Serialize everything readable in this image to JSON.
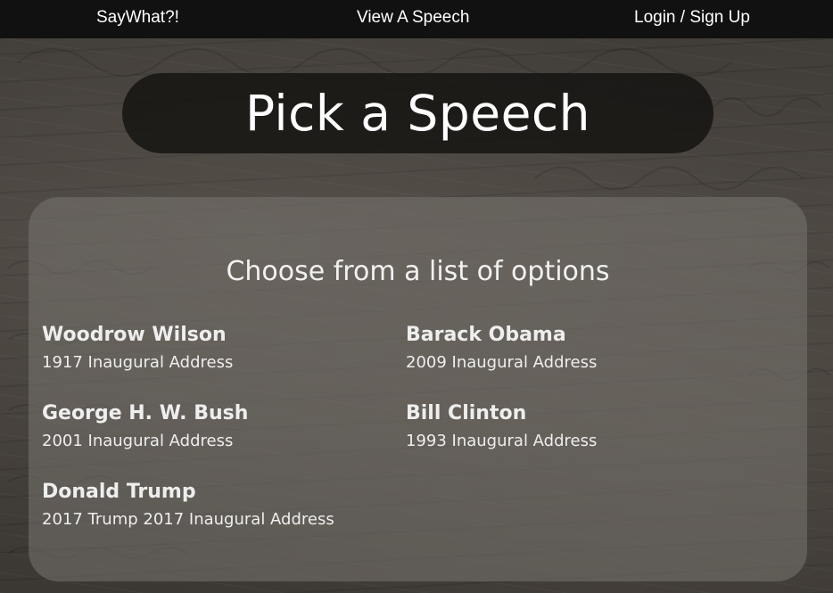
{
  "nav": {
    "brand": "SayWhat?!",
    "view_speech": "View A Speech",
    "login": "Login / Sign Up"
  },
  "page": {
    "title": "Pick a Speech"
  },
  "panel": {
    "heading": "Choose from a list of options",
    "options": [
      {
        "name": "Woodrow Wilson",
        "description": "1917 Inaugural Address"
      },
      {
        "name": "Barack Obama",
        "description": "2009 Inaugural Address"
      },
      {
        "name": "George H. W. Bush",
        "description": "2001 Inaugural Address"
      },
      {
        "name": "Bill Clinton",
        "description": "1993 Inaugural Address"
      },
      {
        "name": "Donald Trump",
        "description": "2017 Trump 2017 Inaugural Address"
      }
    ]
  },
  "colors": {
    "topbar": "#111111",
    "title_pill": "#141210",
    "text": "#ffffff"
  }
}
